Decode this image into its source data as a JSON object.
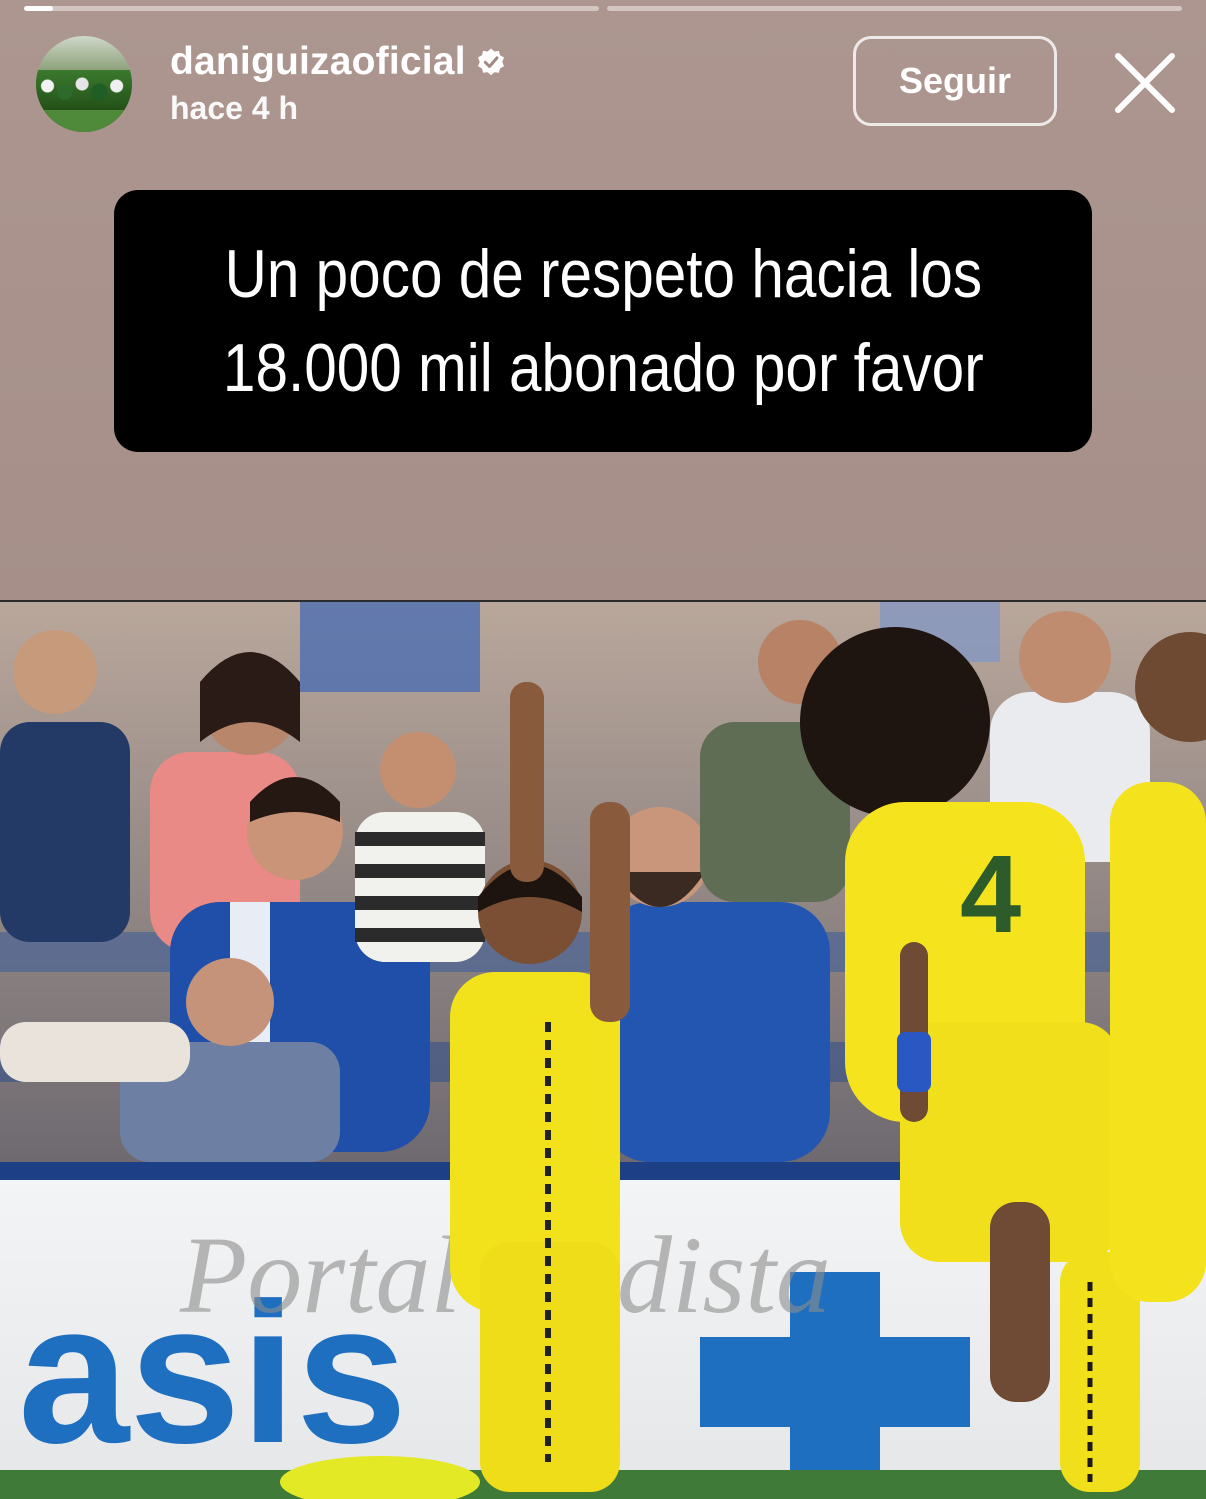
{
  "story": {
    "progress": [
      {
        "fraction": 0.05
      },
      {
        "fraction": 0
      }
    ],
    "header": {
      "username": "daniguizaoficial",
      "time": "hace 4 h",
      "follow_label": "Seguir"
    },
    "caption": {
      "lines": [
        "Un poco de respeto hacia los",
        "18.000 mil abonado por favor"
      ]
    },
    "photo": {
      "watermark": "Portal Cadista",
      "ad_text": "asis",
      "player_number": "4"
    }
  },
  "colors": {
    "background": "#a18a83",
    "caption_bg": "#000000",
    "kit_yellow": "#f2e21c",
    "fan_blue": "#1f4fa8"
  }
}
